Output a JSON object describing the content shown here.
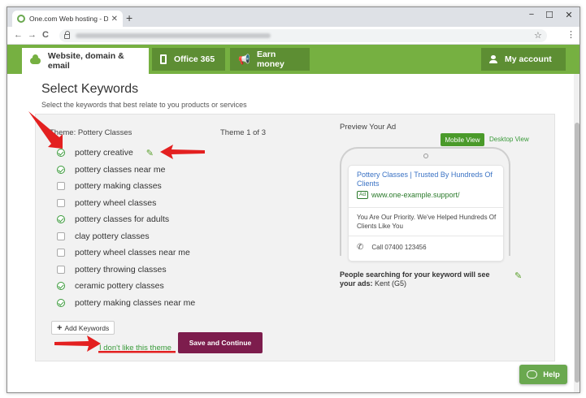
{
  "browser": {
    "tab_title": "One.com Web hosting - Doma",
    "new_tab": "+",
    "minimize": "−",
    "maximize": "☐",
    "close": "✕",
    "tab_close": "✕",
    "back": "←",
    "forward": "→",
    "reload": "C",
    "bookmark": "☆",
    "menu": "⋮"
  },
  "nav": {
    "tabs": [
      {
        "label": "Website, domain & email",
        "active": true
      },
      {
        "label": "Office 365",
        "active": false
      },
      {
        "label": "Earn money",
        "active": false
      }
    ],
    "account": "My account"
  },
  "page": {
    "title": "Select Keywords",
    "subtitle": "Select the keywords that best relate to you products or services"
  },
  "theme": {
    "label": "Theme: Pottery Classes",
    "count": "Theme 1 of 3"
  },
  "keywords": [
    {
      "text": "pottery creative",
      "selected": true
    },
    {
      "text": "pottery classes near me",
      "selected": true
    },
    {
      "text": "pottery making classes",
      "selected": false
    },
    {
      "text": "pottery wheel classes",
      "selected": false
    },
    {
      "text": "pottery classes for adults",
      "selected": true
    },
    {
      "text": "clay pottery classes",
      "selected": false
    },
    {
      "text": "pottery wheel classes near me",
      "selected": false
    },
    {
      "text": "pottery throwing classes",
      "selected": false
    },
    {
      "text": "ceramic pottery classes",
      "selected": true
    },
    {
      "text": "pottery making classes near me",
      "selected": true
    }
  ],
  "actions": {
    "add_keywords": "Add Keywords",
    "dislike_theme": "I don't like this theme",
    "save_continue": "Save and Continue"
  },
  "preview": {
    "label": "Preview Your Ad",
    "mobile_view": "Mobile View",
    "desktop_view": "Desktop View",
    "ad": {
      "headline": "Pottery Classes | Trusted By Hundreds Of Clients",
      "badge": "Ad",
      "url": "www.one-example.support/",
      "description": "You Are Our Priority. We've Helped Hundreds Of Clients Like You",
      "call": "Call 07400 123456"
    },
    "people_bold": "People searching for your keyword will see your ads:",
    "people_location": " Kent (G5)"
  },
  "help": "Help",
  "colors": {
    "nav_green": "#76b041",
    "accent_green": "#3a9a3a",
    "save_button": "#7d1d4d",
    "annotation_red": "#e32020"
  }
}
